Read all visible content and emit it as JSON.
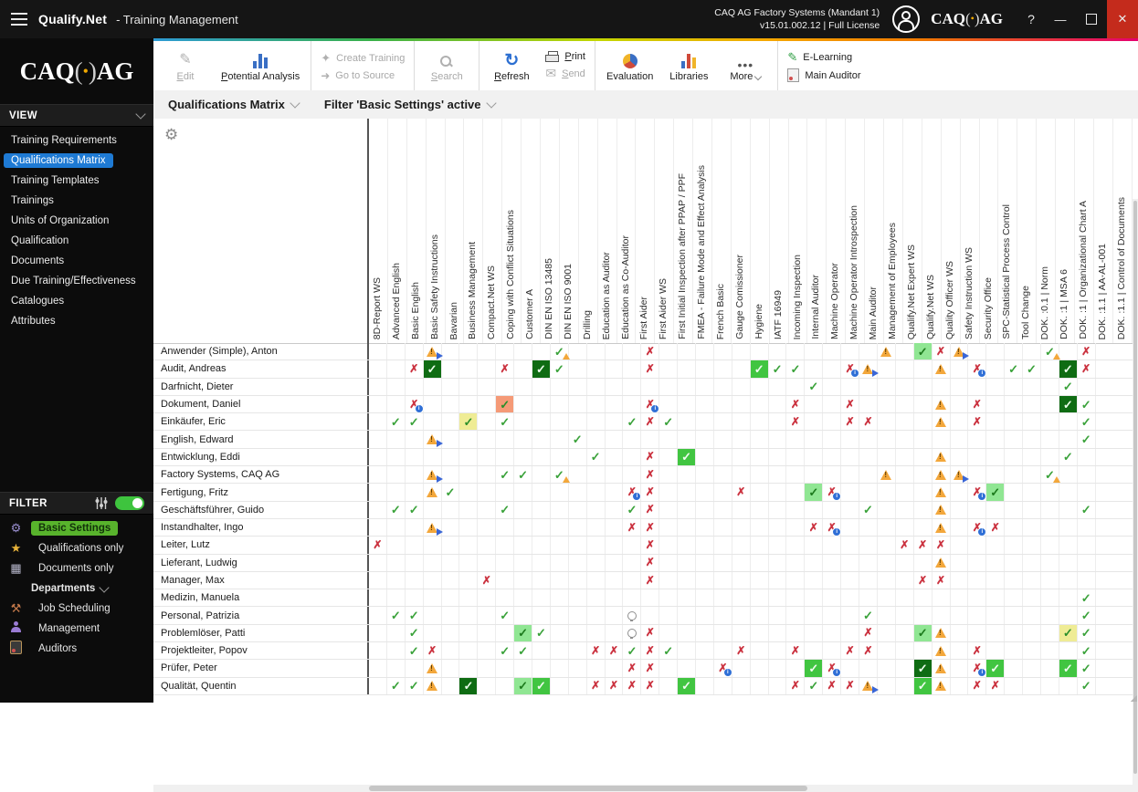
{
  "titlebar": {
    "app": "Qualify.Net",
    "module": "- Training Management",
    "license_line1": "CAQ AG Factory Systems (Mandant 1)",
    "license_line2": "v15.01.002.12 | Full License",
    "help": "?"
  },
  "logo": {
    "caq": "CAQ",
    "ag": "AG"
  },
  "toolbar": {
    "edit": "Edit",
    "potential_analysis": "Potential Analysis",
    "create_training": "Create Training",
    "go_to_source": "Go to Source",
    "search": "Search",
    "refresh": "Refresh",
    "print": "Print",
    "send": "Send",
    "evaluation": "Evaluation",
    "libraries": "Libraries",
    "more": "More",
    "e_learning": "E-Learning",
    "main_auditor": "Main Auditor"
  },
  "page": {
    "title": "Qualifications Matrix",
    "filter_status": "Filter 'Basic Settings' active"
  },
  "sidebar": {
    "view": {
      "label": "VIEW",
      "items": [
        "Training Requirements",
        "Qualifications Matrix",
        "Training Templates",
        "Trainings",
        "Units of Organization",
        "Qualification",
        "Documents",
        "Due Training/Effectiveness",
        "Catalogues",
        "Attributes"
      ],
      "selected": "Qualifications Matrix"
    },
    "filter": {
      "label": "FILTER",
      "items": [
        {
          "icon": "settings-icon",
          "label": "Basic Settings",
          "active": true
        },
        {
          "icon": "star-icon",
          "label": "Qualifications only"
        },
        {
          "icon": "documents-icon",
          "label": "Documents only"
        },
        {
          "icon": "",
          "label": "Departments",
          "group": true
        },
        {
          "icon": "tools-icon",
          "label": "Job Scheduling"
        },
        {
          "icon": "person-icon",
          "label": "Management"
        },
        {
          "icon": "clipboard-icon",
          "label": "Auditors"
        }
      ]
    }
  },
  "matrix": {
    "columns": [
      "8D-Report WS",
      "Advanced English",
      "Basic English",
      "Basic Safety Instructions",
      "Bavarian",
      "Business Management",
      "Compact.Net WS",
      "Coping with Conflict Situations",
      "Customer A",
      "DIN EN ISO 13485",
      "DIN EN ISO 9001",
      "Drilling",
      "Education as Auditor",
      "Education as Co-Auditor",
      "First Aider",
      "First Aider WS",
      "First Initial Inspection after PPAP / PPF",
      "FMEA - Failure Mode and Effect Analysis",
      "French Basic",
      "Gauge Comissioner",
      "Hygiene",
      "IATF 16949",
      "Incoming Inspection",
      "Internal Auditor",
      "Machine Operator",
      "Machine Operator Introspection",
      "Main Auditor",
      "Management of Employees",
      "Qualify.Net Expert WS",
      "Qualify.Net WS",
      "Quality Officer WS",
      "Safety Instruction WS",
      "Security Office",
      "SPC-Statistical Process Control",
      "Tool Change",
      "DOK. :0.1 | Norm",
      "DOK. :1 | MSA 6",
      "DOK. :1 | Organizational Chart A",
      "DOK. :1.1 | AA-AL-001",
      "DOK. :1.1 | Control of Documents"
    ],
    "rows": [
      "Anwender (Simple), Anton",
      "Audit, Andreas",
      "Darfnicht, Dieter",
      "Dokument, Daniel",
      "Einkäufer, Eric",
      "English, Edward",
      "Entwicklung, Eddi",
      "Factory Systems, CAQ AG",
      "Fertigung, Fritz",
      "Geschäftsführer, Guido",
      "Instandhalter, Ingo",
      "Leiter, Lutz",
      "Lieferant, Ludwig",
      "Manager, Max",
      "Medizin, Manuela",
      "Personal, Patrizia",
      "Problemlöser, Patti",
      "Projektleiter, Popov",
      "Prüfer, Peter",
      "Qualität, Quentin"
    ],
    "status_types": {
      "c": "qualified-check",
      "cd": "qualified-check-darkgreen-cell",
      "cg": "qualified-check-green-cell",
      "cl": "qualified-check-lightgreen-cell",
      "cy": "qualified-check-yellow-cell",
      "co": "qualified-check-orange-cell",
      "cw": "qualified-check-with-warning",
      "x": "not-qualified-x",
      "xi": "not-qualified-x-with-info",
      "w": "training-due-warning",
      "wp": "training-due-warning-with-planned",
      "b": "planned-bulb"
    },
    "status_colors": {
      "check": "#3aa23a",
      "x": "#cb3340",
      "warning": "#f3a73b",
      "info": "#2f6fd6",
      "cell_dark_green": "#0f6c13",
      "cell_green": "#41c541",
      "cell_light_green": "#90e693",
      "cell_yellow": "#efec95",
      "cell_orange": "#f59a77"
    },
    "cells": [
      [
        0,
        3,
        "wp"
      ],
      [
        0,
        10,
        "cw"
      ],
      [
        0,
        15,
        "x"
      ],
      [
        0,
        28,
        "w"
      ],
      [
        0,
        30,
        "cl"
      ],
      [
        0,
        31,
        "x"
      ],
      [
        0,
        32,
        "wp"
      ],
      [
        0,
        37,
        "cw"
      ],
      [
        0,
        39,
        "x"
      ],
      [
        1,
        2,
        "x"
      ],
      [
        1,
        3,
        "cd"
      ],
      [
        1,
        7,
        "x"
      ],
      [
        1,
        9,
        "cd"
      ],
      [
        1,
        10,
        "c"
      ],
      [
        1,
        15,
        "x"
      ],
      [
        1,
        21,
        "cg"
      ],
      [
        1,
        22,
        "c"
      ],
      [
        1,
        23,
        "c"
      ],
      [
        1,
        26,
        "xi"
      ],
      [
        1,
        27,
        "wp"
      ],
      [
        1,
        31,
        "w"
      ],
      [
        1,
        33,
        "xi"
      ],
      [
        1,
        35,
        "c"
      ],
      [
        1,
        36,
        "c"
      ],
      [
        1,
        38,
        "cd"
      ],
      [
        1,
        39,
        "x"
      ],
      [
        2,
        24,
        "c"
      ],
      [
        2,
        38,
        "c"
      ],
      [
        3,
        2,
        "xi"
      ],
      [
        3,
        7,
        "co"
      ],
      [
        3,
        15,
        "xi"
      ],
      [
        3,
        23,
        "x"
      ],
      [
        3,
        26,
        "x"
      ],
      [
        3,
        31,
        "w"
      ],
      [
        3,
        33,
        "x"
      ],
      [
        3,
        38,
        "cd"
      ],
      [
        3,
        39,
        "c"
      ],
      [
        4,
        1,
        "c"
      ],
      [
        4,
        2,
        "c"
      ],
      [
        4,
        5,
        "cy"
      ],
      [
        4,
        7,
        "c"
      ],
      [
        4,
        14,
        "c"
      ],
      [
        4,
        15,
        "x"
      ],
      [
        4,
        16,
        "c"
      ],
      [
        4,
        23,
        "x"
      ],
      [
        4,
        26,
        "x"
      ],
      [
        4,
        27,
        "x"
      ],
      [
        4,
        31,
        "w"
      ],
      [
        4,
        33,
        "x"
      ],
      [
        4,
        39,
        "c"
      ],
      [
        5,
        3,
        "wp"
      ],
      [
        5,
        11,
        "c"
      ],
      [
        5,
        39,
        "c"
      ],
      [
        6,
        12,
        "c"
      ],
      [
        6,
        15,
        "x"
      ],
      [
        6,
        17,
        "cg"
      ],
      [
        6,
        31,
        "w"
      ],
      [
        6,
        38,
        "c"
      ],
      [
        7,
        3,
        "wp"
      ],
      [
        7,
        7,
        "c"
      ],
      [
        7,
        8,
        "c"
      ],
      [
        7,
        10,
        "cw"
      ],
      [
        7,
        15,
        "x"
      ],
      [
        7,
        28,
        "w"
      ],
      [
        7,
        31,
        "w"
      ],
      [
        7,
        32,
        "wp"
      ],
      [
        7,
        37,
        "cw"
      ],
      [
        8,
        3,
        "w"
      ],
      [
        8,
        4,
        "c"
      ],
      [
        8,
        14,
        "xi"
      ],
      [
        8,
        15,
        "x"
      ],
      [
        8,
        20,
        "x"
      ],
      [
        8,
        24,
        "cl"
      ],
      [
        8,
        25,
        "xi"
      ],
      [
        8,
        31,
        "w"
      ],
      [
        8,
        33,
        "xi"
      ],
      [
        8,
        34,
        "cl"
      ],
      [
        9,
        1,
        "c"
      ],
      [
        9,
        2,
        "c"
      ],
      [
        9,
        7,
        "c"
      ],
      [
        9,
        14,
        "c"
      ],
      [
        9,
        15,
        "x"
      ],
      [
        9,
        27,
        "c"
      ],
      [
        9,
        31,
        "w"
      ],
      [
        9,
        39,
        "c"
      ],
      [
        10,
        3,
        "wp"
      ],
      [
        10,
        14,
        "x"
      ],
      [
        10,
        15,
        "x"
      ],
      [
        10,
        24,
        "x"
      ],
      [
        10,
        25,
        "xi"
      ],
      [
        10,
        31,
        "w"
      ],
      [
        10,
        33,
        "xi"
      ],
      [
        10,
        34,
        "x"
      ],
      [
        11,
        0,
        "x"
      ],
      [
        11,
        15,
        "x"
      ],
      [
        11,
        29,
        "x"
      ],
      [
        11,
        30,
        "x"
      ],
      [
        11,
        31,
        "x"
      ],
      [
        12,
        15,
        "x"
      ],
      [
        12,
        31,
        "w"
      ],
      [
        13,
        6,
        "x"
      ],
      [
        13,
        15,
        "x"
      ],
      [
        13,
        30,
        "x"
      ],
      [
        13,
        31,
        "x"
      ],
      [
        14,
        39,
        "c"
      ],
      [
        15,
        1,
        "c"
      ],
      [
        15,
        2,
        "c"
      ],
      [
        15,
        7,
        "c"
      ],
      [
        15,
        14,
        "b"
      ],
      [
        15,
        27,
        "c"
      ],
      [
        15,
        39,
        "c"
      ],
      [
        16,
        2,
        "c"
      ],
      [
        16,
        8,
        "cl"
      ],
      [
        16,
        9,
        "c"
      ],
      [
        16,
        14,
        "b"
      ],
      [
        16,
        15,
        "x"
      ],
      [
        16,
        27,
        "x"
      ],
      [
        16,
        30,
        "cl"
      ],
      [
        16,
        31,
        "w"
      ],
      [
        16,
        38,
        "cy"
      ],
      [
        16,
        39,
        "c"
      ],
      [
        17,
        2,
        "c"
      ],
      [
        17,
        3,
        "x"
      ],
      [
        17,
        7,
        "c"
      ],
      [
        17,
        8,
        "c"
      ],
      [
        17,
        12,
        "x"
      ],
      [
        17,
        13,
        "x"
      ],
      [
        17,
        14,
        "c"
      ],
      [
        17,
        15,
        "x"
      ],
      [
        17,
        16,
        "c"
      ],
      [
        17,
        20,
        "x"
      ],
      [
        17,
        23,
        "x"
      ],
      [
        17,
        26,
        "x"
      ],
      [
        17,
        27,
        "x"
      ],
      [
        17,
        31,
        "w"
      ],
      [
        17,
        33,
        "x"
      ],
      [
        17,
        39,
        "c"
      ],
      [
        18,
        3,
        "w"
      ],
      [
        18,
        14,
        "x"
      ],
      [
        18,
        15,
        "x"
      ],
      [
        18,
        19,
        "xi"
      ],
      [
        18,
        24,
        "cg"
      ],
      [
        18,
        25,
        "xi"
      ],
      [
        18,
        30,
        "cd"
      ],
      [
        18,
        31,
        "w"
      ],
      [
        18,
        33,
        "xi"
      ],
      [
        18,
        34,
        "cg"
      ],
      [
        18,
        38,
        "cg"
      ],
      [
        18,
        39,
        "c"
      ],
      [
        19,
        1,
        "c"
      ],
      [
        19,
        2,
        "c"
      ],
      [
        19,
        3,
        "w"
      ],
      [
        19,
        5,
        "cd"
      ],
      [
        19,
        8,
        "cl"
      ],
      [
        19,
        9,
        "cg"
      ],
      [
        19,
        12,
        "x"
      ],
      [
        19,
        13,
        "x"
      ],
      [
        19,
        14,
        "x"
      ],
      [
        19,
        15,
        "x"
      ],
      [
        19,
        17,
        "cg"
      ],
      [
        19,
        23,
        "x"
      ],
      [
        19,
        24,
        "c"
      ],
      [
        19,
        25,
        "x"
      ],
      [
        19,
        26,
        "x"
      ],
      [
        19,
        27,
        "wp"
      ],
      [
        19,
        30,
        "cg"
      ],
      [
        19,
        31,
        "w"
      ],
      [
        19,
        33,
        "x"
      ],
      [
        19,
        34,
        "x"
      ],
      [
        19,
        39,
        "c"
      ]
    ]
  }
}
